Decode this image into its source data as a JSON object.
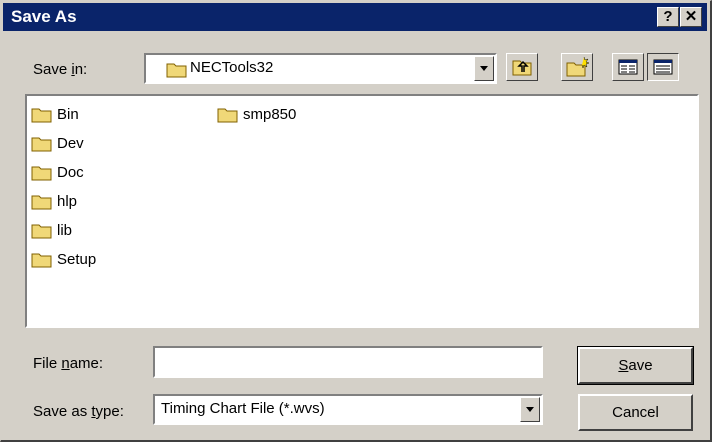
{
  "window": {
    "title": "Save As",
    "help_label": "?",
    "close_label": "✕"
  },
  "save_in": {
    "label_pre": "Save ",
    "label_mnemonic": "i",
    "label_post": "n:",
    "value": "NECTools32"
  },
  "toolbar": {
    "up_icon": "up-one-level-icon",
    "new_folder_icon": "new-folder-icon",
    "list_icon": "list-view-icon",
    "details_icon": "details-view-icon"
  },
  "files": {
    "column1": [
      "Bin",
      "Dev",
      "Doc",
      "hlp",
      "lib",
      "Setup"
    ],
    "column2": [
      "smp850"
    ]
  },
  "file_name": {
    "label_pre": "File ",
    "label_mnemonic": "n",
    "label_post": "ame:",
    "value": ""
  },
  "save_type": {
    "label_pre": "Save as ",
    "label_mnemonic": "t",
    "label_post": "ype:",
    "value": "Timing Chart File (*.wvs)"
  },
  "buttons": {
    "save_mnemonic": "S",
    "save_rest": "ave",
    "cancel": "Cancel"
  },
  "colors": {
    "titlebar": "#0a246a",
    "face": "#d4d0c8",
    "folder": "#f0d878"
  }
}
